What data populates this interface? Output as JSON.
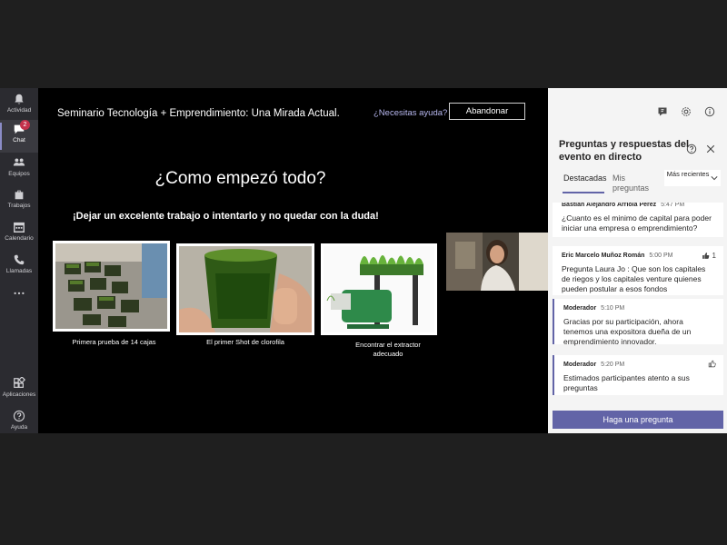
{
  "rail": {
    "items": [
      {
        "label": "Actividad",
        "icon": "bell-icon"
      },
      {
        "label": "Chat",
        "icon": "chat-icon",
        "badge": "2"
      },
      {
        "label": "Equipos",
        "icon": "teams-icon"
      },
      {
        "label": "Trabajos",
        "icon": "briefcase-icon"
      },
      {
        "label": "Calendario",
        "icon": "calendar-icon"
      },
      {
        "label": "Llamadas",
        "icon": "phone-icon"
      },
      {
        "label": "",
        "icon": "more-icon"
      },
      {
        "label": "Aplicaciones",
        "icon": "apps-icon"
      },
      {
        "label": "Ayuda",
        "icon": "help-icon"
      }
    ]
  },
  "meeting": {
    "title": "Seminario Tecnología + Emprendimiento: Una Mirada Actual.",
    "help_link": "¿Necesitas ayuda?",
    "leave_button": "Abandonar"
  },
  "slide": {
    "title": "¿Como empezó todo?",
    "subtitle": "¡Dejar un excelente trabajo o  intentarlo y no quedar con la duda!",
    "photos": [
      {
        "caption": "Primera prueba de 14 cajas"
      },
      {
        "caption": "El primer Shot de clorofila"
      },
      {
        "caption": "Encontrar el extractor\nadecuado"
      }
    ]
  },
  "panel": {
    "title": "Preguntas y respuestas del evento en directo",
    "tabs": [
      "Destacadas",
      "Mis preguntas"
    ],
    "sort_label": "Más recientes",
    "questions": [
      {
        "author": "Bastián Alejandro Arriola Pérez",
        "time": "5:47 PM",
        "text": "¿Cuanto es el minimo de capital para poder iniciar una empresa o emprendimiento?"
      },
      {
        "author": "Eric Marcelo Muñoz Román",
        "time": "5:00 PM",
        "likes": "1",
        "text": "Pregunta Laura Jo : Que son los capitales de riegos y los capitales venture quienes pueden postular a esos fondos"
      }
    ],
    "replies": [
      {
        "author": "Moderador",
        "time": "5:10 PM",
        "text": "Gracias por su participación, ahora tenemos una expositora dueña de un emprendimiento innovador."
      },
      {
        "author": "Moderador",
        "time": "5:20 PM",
        "text": "Estimados participantes atento a sus preguntas"
      }
    ],
    "ask_button": "Haga una pregunta"
  },
  "colors": {
    "accent": "#6264a7",
    "rail_bg": "#2b2b30",
    "badge": "#c4314b",
    "panel_bg": "#f4f4f4"
  }
}
